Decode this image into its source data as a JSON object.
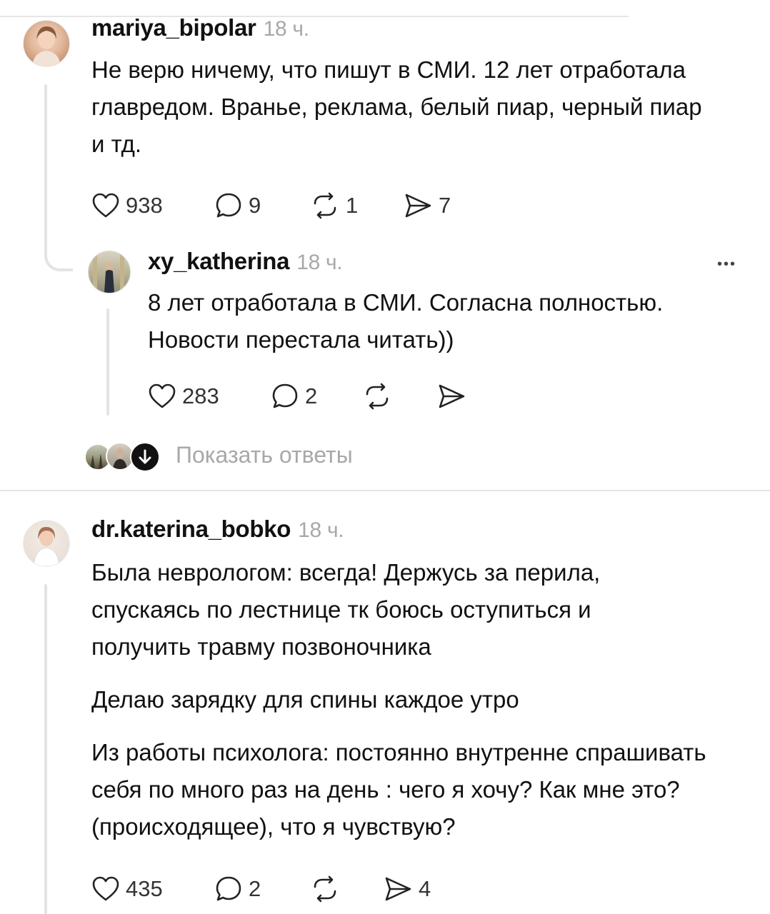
{
  "comments": [
    {
      "username": "mariya_bipolar",
      "time": "18 ч.",
      "text": [
        "Не верю ничему, что пишут в СМИ. 12 лет отработала главредом. Вранье, реклама, белый пиар, черный пиар и тд."
      ],
      "likes": "938",
      "replies": "9",
      "reposts": "1",
      "shares": "7"
    },
    {
      "username": "xy_katherina",
      "time": "18 ч.",
      "more": "•••",
      "text": [
        "8 лет отработала в СМИ. Согласна полностью. Новости перестала читать))"
      ],
      "likes": "283",
      "replies": "2",
      "reposts": "",
      "shares": ""
    },
    {
      "username": "dr.katerina_bobko",
      "time": "18 ч.",
      "text": [
        "Была неврологом: всегда! Держусь за перила, спускаясь по лестнице тк боюсь оступиться и получить травму позвоночника",
        "Делаю зарядку для спины каждое утро",
        "Из работы психолога: постоянно внутренне спрашивать себя по много раз на день : чего я хочу? Как мне это?(происходящее), что я чувствую?"
      ],
      "likes": "435",
      "replies": "2",
      "reposts": "",
      "shares": "4"
    }
  ],
  "show_replies_label": "Показать ответы",
  "icons": {
    "like": "heart-icon",
    "reply": "comment-bubble-icon",
    "repost": "repost-icon",
    "share": "send-icon",
    "more": "more-icon",
    "down": "arrow-down-icon"
  }
}
